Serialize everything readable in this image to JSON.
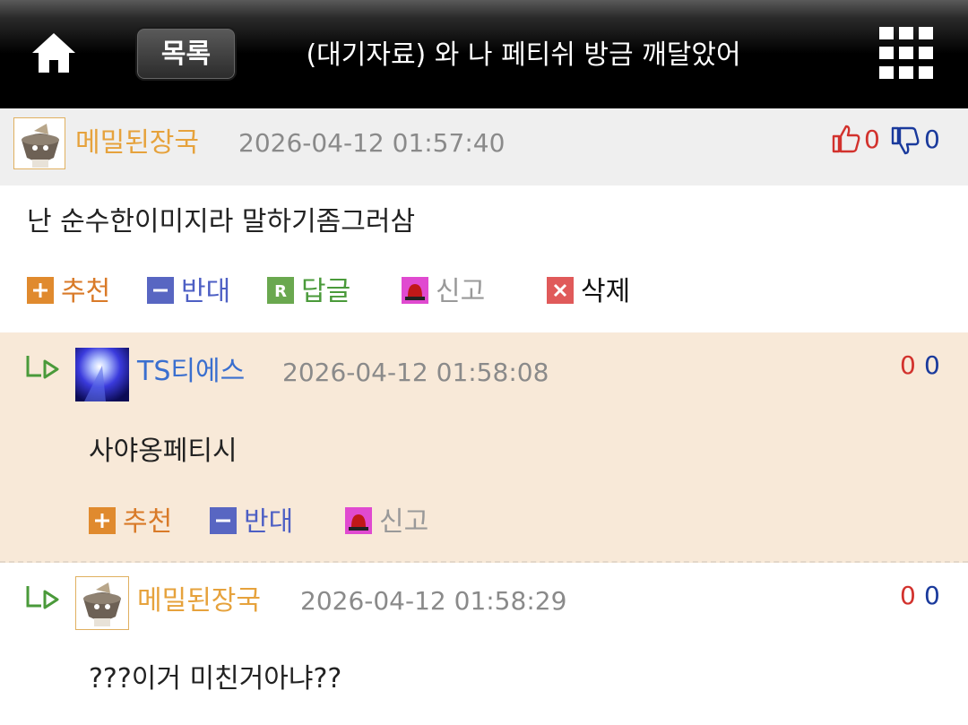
{
  "header": {
    "list_label": "목록",
    "title": "(대기자료) 와 나 페티쉬 방금 깨달았어"
  },
  "comments": [
    {
      "nickname": "메밀된장국",
      "datetime": "2026-04-12 01:57:40",
      "text": "난 순수한이미지라 말하기좀그러삼",
      "up": "0",
      "down": "0",
      "actions": {
        "recommend": "추천",
        "oppose": "반대",
        "reply": "답글",
        "report": "신고",
        "delete": "삭제"
      }
    },
    {
      "nickname": "TS티에스",
      "datetime": "2026-04-12 01:58:08",
      "text": "사야옹페티시",
      "up": "0",
      "down": "0",
      "actions": {
        "recommend": "추천",
        "oppose": "반대",
        "report": "신고"
      }
    },
    {
      "nickname": "메밀된장국",
      "datetime": "2026-04-12 01:58:29",
      "text": "???이거 미친거아냐??",
      "up": "0",
      "down": "0"
    }
  ],
  "colors": {
    "header_bg": "#000000",
    "nick_orange": "#e6a23c",
    "nick_blue": "#3a6fcf",
    "reply_bg": "#f8e9d8",
    "up_red": "#d2322d",
    "down_navy": "#1a3a9c"
  }
}
